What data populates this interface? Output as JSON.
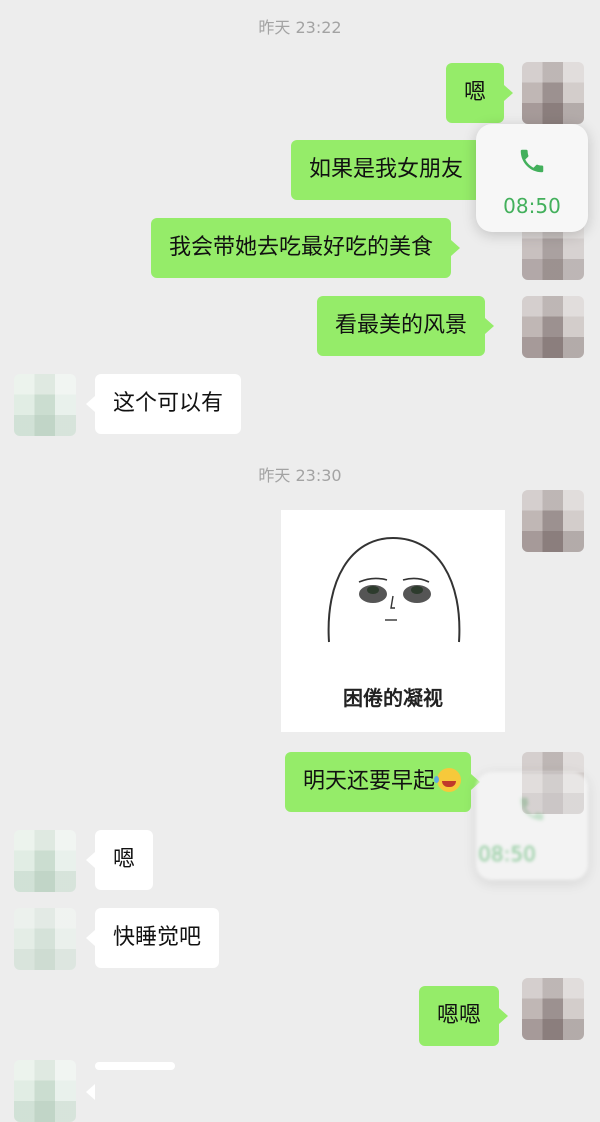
{
  "timestamps": [
    "昨天 23:22",
    "昨天 23:30"
  ],
  "messages": [
    {
      "side": "out",
      "text": "嗯"
    },
    {
      "side": "out",
      "text": "如果是我女朋友"
    },
    {
      "side": "out",
      "text": "我会带她去吃最好吃的美食"
    },
    {
      "side": "out",
      "text": "看最美的风景"
    },
    {
      "side": "in",
      "text": "这个可以有"
    },
    {
      "side": "out",
      "type": "sticker",
      "caption": "困倦的凝视"
    },
    {
      "side": "out",
      "text": "明天还要早起",
      "emoji": "crying-laughing"
    },
    {
      "side": "in",
      "text": "嗯"
    },
    {
      "side": "in",
      "text": "快睡觉吧"
    },
    {
      "side": "out",
      "text": "嗯嗯"
    }
  ],
  "call_widget": {
    "time": "08:50",
    "icon": "phone-icon",
    "color": "#43b05c"
  },
  "colors": {
    "outgoing_bubble": "#95ec69",
    "incoming_bubble": "#ffffff",
    "background": "#ededed"
  }
}
